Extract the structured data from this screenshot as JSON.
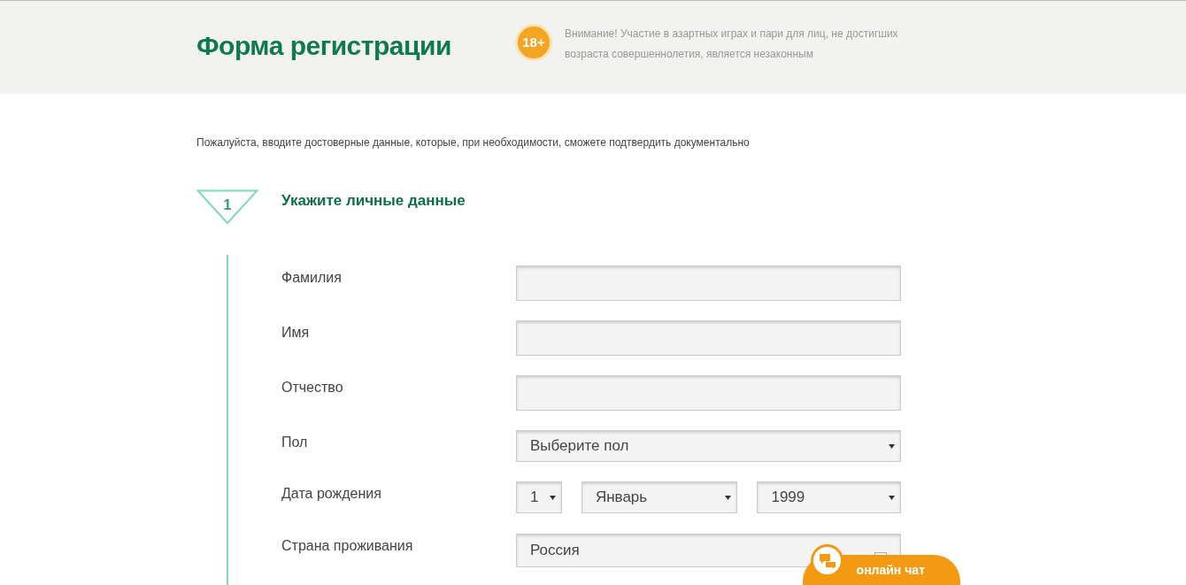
{
  "header": {
    "title": "Форма регистрации",
    "age_badge": "18+",
    "warning": "Внимание! Участие в азартных играх и пари для лиц, не достигших возраста совершеннолетия, является незаконным"
  },
  "intro": "Пожалуйста, вводите достоверные данные, которые, при необходимости, сможете подтвердить документально",
  "step": {
    "number": "1",
    "title": "Укажите личные данные"
  },
  "fields": [
    {
      "kind": "text",
      "label": "Фамилия"
    },
    {
      "kind": "text",
      "label": "Имя"
    },
    {
      "kind": "text",
      "label": "Отчество"
    },
    {
      "kind": "select",
      "label": "Пол",
      "value": "Выберите пол"
    },
    {
      "kind": "date",
      "label": "Дата рождения",
      "parts": [
        "1",
        "Январь",
        "1999"
      ]
    },
    {
      "kind": "country",
      "label": "Страна проживания",
      "value": "Россия"
    }
  ],
  "chat": {
    "label": "онлайн чат"
  }
}
